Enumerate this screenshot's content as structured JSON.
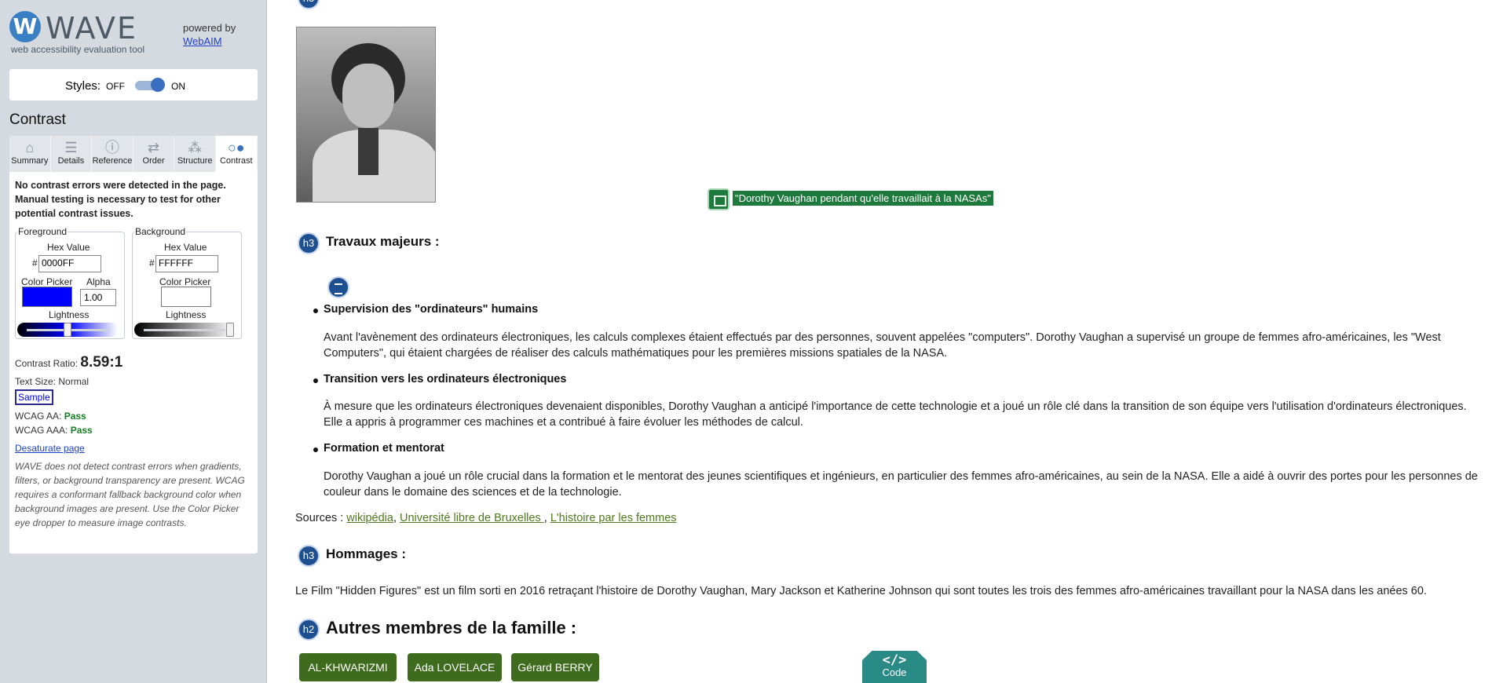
{
  "wave": {
    "logo_word": "WAVE",
    "tagline": "web accessibility evaluation tool",
    "powered_by": "powered by",
    "webaim_link": "WebAIM",
    "styles_label": "Styles:",
    "styles_off": "OFF",
    "styles_on": "ON",
    "panel_title": "Contrast",
    "tabs": [
      {
        "label": "Summary",
        "icon": "home-icon"
      },
      {
        "label": "Details",
        "icon": "list-icon"
      },
      {
        "label": "Reference",
        "icon": "info-icon"
      },
      {
        "label": "Order",
        "icon": "order-icon"
      },
      {
        "label": "Structure",
        "icon": "structure-icon"
      },
      {
        "label": "Contrast",
        "icon": "contrast-icon",
        "active": true
      }
    ],
    "contrast_message": "No contrast errors were detected in the page. Manual testing is necessary to test for other potential contrast issues.",
    "foreground": {
      "legend": "Foreground",
      "hex_label": "Hex Value",
      "hash": "#",
      "hex_value": "0000FF",
      "picker_label": "Color Picker",
      "alpha_label": "Alpha",
      "alpha_value": "1.00",
      "lightness_label": "Lightness",
      "swatch_color": "#0000ff",
      "lightness_level": 0.5
    },
    "background": {
      "legend": "Background",
      "hex_label": "Hex Value",
      "hash": "#",
      "hex_value": "FFFFFF",
      "picker_label": "Color Picker",
      "lightness_label": "Lightness",
      "swatch_color": "#ffffff",
      "lightness_level": 1.0
    },
    "ratio_label": "Contrast Ratio:",
    "ratio_value": "8.59:1",
    "text_size": "Text Size: Normal",
    "sample": "Sample",
    "wcag_aa_label": "WCAG AA:",
    "wcag_aa": "Pass",
    "wcag_aaa_label": "WCAG AAA:",
    "wcag_aaa": "Pass",
    "desaturate_link": "Desaturate page",
    "note": "WAVE does not detect contrast errors when gradients, filters, or background transparency are present. WCAG requires a conformant fallback background color when background images are present. Use the Color Picker eye dropper to measure image contrasts."
  },
  "doc": {
    "h3_badge": "h3",
    "h2_badge": "h2",
    "caption": "\"Dorothy Vaughan pendant qu'elle travaillait à la NASAs\"",
    "travaux_heading": "Travaux majeurs :",
    "items": [
      {
        "title": "Supervision des \"ordinateurs\" humains",
        "text": "Avant l'avènement des ordinateurs électroniques, les calculs complexes étaient effectués par des personnes, souvent appelées \"computers\". Dorothy Vaughan a supervisé un groupe de femmes afro-américaines, les \"West Computers\", qui étaient chargées de réaliser des calculs mathématiques pour les premières missions spatiales de la NASA."
      },
      {
        "title": "Transition vers les ordinateurs électroniques",
        "text": "À mesure que les ordinateurs électroniques devenaient disponibles, Dorothy Vaughan a anticipé l'importance de cette technologie et a joué un rôle clé dans la transition de son équipe vers l'utilisation d'ordinateurs électroniques. Elle a appris à programmer ces machines et a contribué à faire évoluer les méthodes de calcul."
      },
      {
        "title": "Formation et mentorat",
        "text": "Dorothy Vaughan a joué un rôle crucial dans la formation et le mentorat des jeunes scientifiques et ingénieurs, en particulier des femmes afro-américaines, au sein de la NASA. Elle a aidé à ouvrir des portes pour les personnes de couleur dans le domaine des sciences et de la technologie."
      }
    ],
    "sources_label": "Sources :",
    "sources": [
      "wikipédia",
      "Université libre de Bruxelles ",
      "L'histoire par les femmes"
    ],
    "hommages_heading": "Hommages :",
    "hommages_text": "Le Film \"Hidden Figures\" est un film sorti en 2016 retraçant l'histoire de Dorothy Vaughan, Mary Jackson et Katherine Johnson qui sont toutes les trois des femmes afro-américaines travaillant pour la NASA dans les anées 60.",
    "famille_heading": "Autres membres de la famille :",
    "family_buttons": [
      "AL-KHWARIZMI",
      "Ada LOVELACE",
      "Gérard BERRY"
    ],
    "code_label": "Code",
    "code_icon": "</>"
  }
}
